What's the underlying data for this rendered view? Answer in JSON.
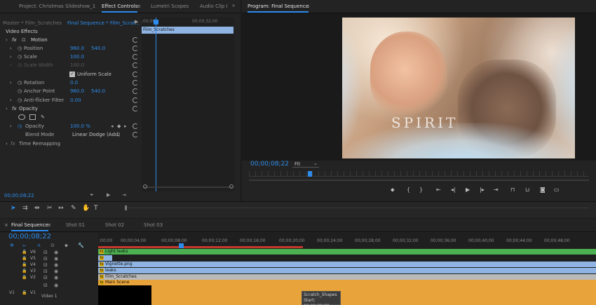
{
  "tabs": {
    "project": "Project: Christmas Slideshow_1",
    "effect_controls": "Effect Controls",
    "lumetri": "Lumetri Scopes",
    "audio_clip": "Audio Clip I",
    "program": "Program: Final Sequence"
  },
  "effect_controls": {
    "master": "Master * Film_Scratches",
    "sequence": "Final Sequence * Film_Scrat...",
    "ruler_time": ";00;00",
    "ruler_time2": "00;00;32;00",
    "clip_bar": "Film_Scratches",
    "section": "Video Effects",
    "motion": "Motion",
    "position": {
      "label": "Position",
      "x": "960.0",
      "y": "540.0"
    },
    "scale": {
      "label": "Scale",
      "value": "100.0"
    },
    "scale_width": {
      "label": "Scale Width",
      "value": "100.0"
    },
    "uniform_scale": "Uniform Scale",
    "rotation": {
      "label": "Rotation",
      "value": "0.0"
    },
    "anchor": {
      "label": "Anchor Point",
      "x": "960.0",
      "y": "540.0"
    },
    "antiflicker": {
      "label": "Anti-flicker Filter",
      "value": "0.00"
    },
    "opacity_section": "Opacity",
    "opacity": {
      "label": "Opacity",
      "value": "100.0 %"
    },
    "blend_mode": {
      "label": "Blend Mode",
      "value": "Linear Dodge (Add)"
    },
    "time_remap": "Time Remapping",
    "timecode": "00;00;08;22"
  },
  "program": {
    "overlay_text": "SPIRIT",
    "timecode": "00;00;08;22",
    "zoom": "Fit"
  },
  "timeline": {
    "tabs": [
      "Final Sequence",
      "Shot 01",
      "Shot 02",
      "Shot 03"
    ],
    "timecode": "00;00;08;22",
    "ruler": [
      ";00;00",
      "00;00;04;00",
      "00;00;08;00",
      "00;00;12;00",
      "00;00;16;00",
      "00;00;20;00",
      "00;00;24;00",
      "00;00;28;00",
      "00;00;32;00",
      "00;00;36;00",
      "00;00;40;00",
      "00;00;44;00",
      "00;00;48;00"
    ],
    "tracks": [
      "V6",
      "V5",
      "V4",
      "V3",
      "V2",
      "V1"
    ],
    "track_src": "V1",
    "track_name": "Video 1",
    "clips": {
      "v6": "Light leaks",
      "v4": "Vignette.png",
      "v3": "leaks",
      "v2": "Film_Scratches",
      "v1": "Main Scene"
    },
    "tooltip": {
      "name": "Scratch_Shapes",
      "start": "Start: 00;00;00;00"
    }
  },
  "colors": {
    "accent": "#2d8ceb",
    "clip_blue": "#8fb4e3",
    "clip_green": "#4cb050",
    "clip_orange": "#e8a43a",
    "fx_yellow": "#d4a70f"
  }
}
